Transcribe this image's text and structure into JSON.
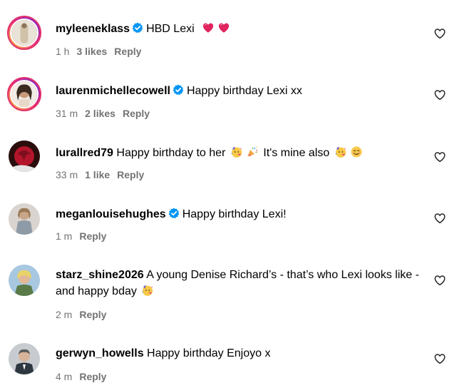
{
  "colors": {
    "meta": "#737373",
    "verified": "#0095f6",
    "heart_emoji": "#e0245e"
  },
  "comments": [
    {
      "username": "myleeneklass",
      "verified": true,
      "text": "HBD Lexi",
      "emojis": [
        "heart",
        "heart"
      ],
      "time": "1 h",
      "likes": "3 likes",
      "reply": "Reply"
    },
    {
      "username": "laurenmichellecowell",
      "verified": true,
      "text": "Happy birthday Lexi xx",
      "emojis": [],
      "time": "31 m",
      "likes": "2 likes",
      "reply": "Reply"
    },
    {
      "username": "lurallred79",
      "verified": false,
      "text": "Happy birthday to her",
      "text2": "It's mine also",
      "emojis": [
        "partying-face",
        "party-popper",
        "partying-face",
        "smiling-face"
      ],
      "time": "33 m",
      "likes": "1 like",
      "reply": "Reply"
    },
    {
      "username": "meganlouisehughes",
      "verified": true,
      "text": "Happy birthday Lexi!",
      "emojis": [],
      "time": "1 m",
      "likes": "",
      "reply": "Reply"
    },
    {
      "username": "starz_shine2026",
      "verified": false,
      "text": "A young Denise Richard’s - that’s who Lexi looks like - and happy bday",
      "emojis": [
        "partying-face"
      ],
      "time": "2 m",
      "likes": "",
      "reply": "Reply"
    },
    {
      "username": "gerwyn_howells",
      "verified": false,
      "text": "Happy birthday Enjoyo x",
      "emojis": [],
      "time": "4 m",
      "likes": "",
      "reply": "Reply"
    }
  ]
}
